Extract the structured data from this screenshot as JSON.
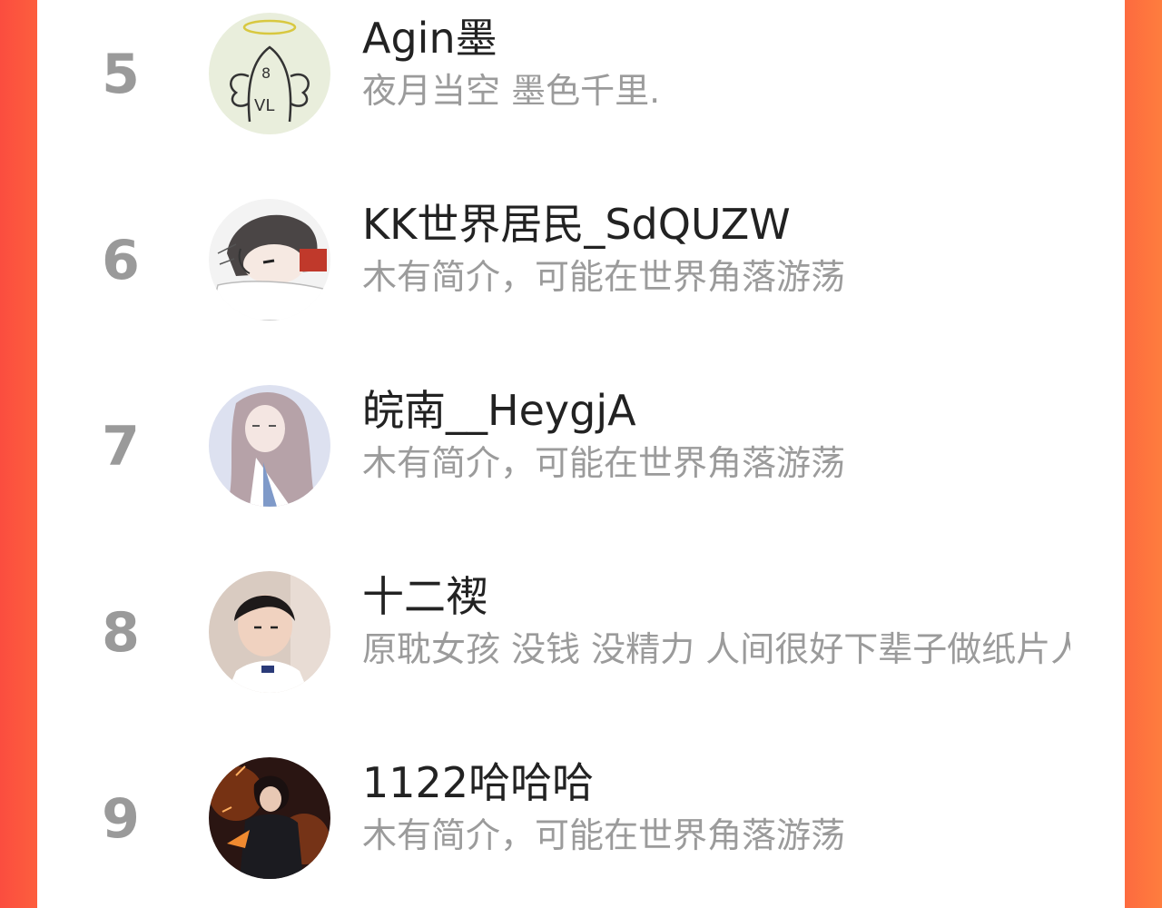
{
  "users": [
    {
      "rank": "5",
      "name": "Agin墨",
      "bio": "夜月当空 墨色千里.",
      "avatar": "angel-sketch-avatar"
    },
    {
      "rank": "6",
      "name": "KK世界居民_SdQUZW",
      "bio": "木有简介，可能在世界角落游荡",
      "avatar": "sleeping-girl-avatar"
    },
    {
      "rank": "7",
      "name": "皖南__HeygjA",
      "bio": "木有简介，可能在世界角落游荡",
      "avatar": "anime-girl-avatar"
    },
    {
      "rank": "8",
      "name": "十二禊",
      "bio": "原耽女孩 没钱 没精力 人间很好下辈子做纸片人",
      "avatar": "photo-person-avatar"
    },
    {
      "rank": "9",
      "name": "1122哈哈哈",
      "bio": "木有简介，可能在世界角落游荡",
      "avatar": "dark-warrior-avatar"
    }
  ],
  "colors": {
    "background_left": "#fb4d3f",
    "background_right": "#fe7d3e",
    "panel": "#ffffff",
    "rank_text": "#9a9a9a",
    "name_text": "#222222",
    "bio_text": "#9b9b9b"
  }
}
